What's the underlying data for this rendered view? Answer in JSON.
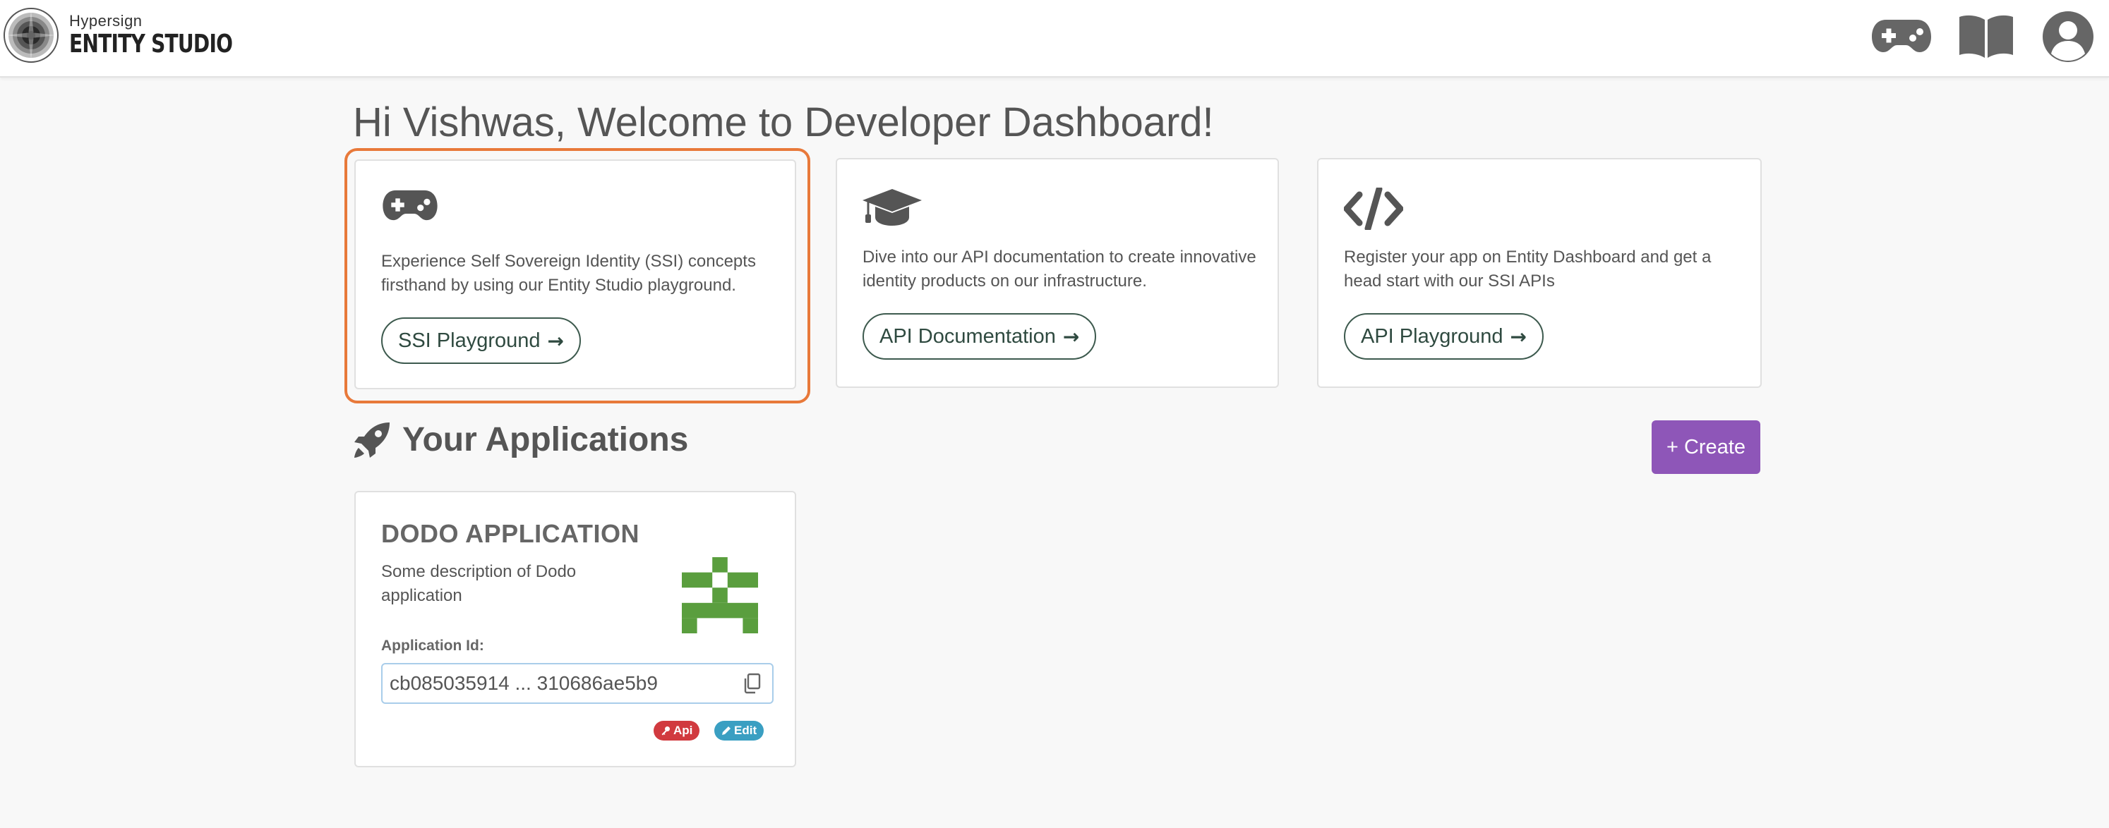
{
  "brand": {
    "subtitle": "Hypersign",
    "title": "ENTITY STUDIO"
  },
  "header_icons": [
    "gamepad-icon",
    "book-icon",
    "user-circle-icon"
  ],
  "welcome": "Hi Vishwas, Welcome to Developer Dashboard!",
  "cards": [
    {
      "icon": "gamepad-icon",
      "description": "Experience Self Sovereign Identity (SSI) concepts firsthand by using our Entity Studio playground.",
      "button": "SSI Playground",
      "highlighted": true
    },
    {
      "icon": "graduation-cap-icon",
      "description": "Dive into our API documentation to create innovative identity products on our infrastructure.",
      "button": "API Documentation"
    },
    {
      "icon": "code-icon",
      "description": "Register your app on Entity Dashboard and get a head start with our SSI APIs",
      "button": "API Playground"
    }
  ],
  "arrow": "→",
  "applications": {
    "title": "Your Applications",
    "create_label": "+ Create",
    "items": [
      {
        "name": "DODO APPLICATION",
        "description": "Some description of Dodo application",
        "app_id_label": "Application Id:",
        "app_id": "cb085035914 ... 310686ae5b9",
        "api_badge": "Api",
        "edit_badge": "Edit"
      }
    ]
  },
  "colors": {
    "accent_purple": "#8e56b8",
    "highlight_orange": "#e8793a",
    "badge_red": "#d13a3f",
    "badge_blue": "#3a9fc2",
    "identicon_green": "#5a9e3e"
  }
}
